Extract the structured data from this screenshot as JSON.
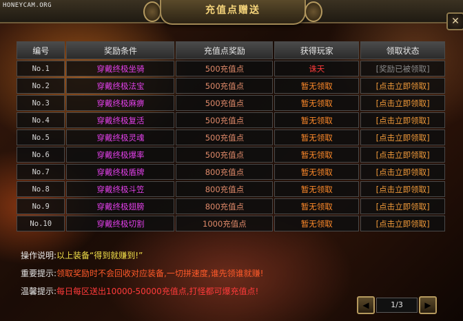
{
  "watermark": "HONEYCAM.ORG",
  "window": {
    "title": "充值点赠送",
    "close_icon": "✕"
  },
  "table": {
    "headers": [
      "编号",
      "奖励条件",
      "充值点奖励",
      "获得玩家",
      "领取状态"
    ],
    "rows": [
      {
        "no": "No.1",
        "condition": "穿戴终极坐骑",
        "reward": "500充值点",
        "player": "诛天",
        "status": "[奖励已被领取]",
        "player_type": "winner",
        "status_type": "claimed"
      },
      {
        "no": "No.2",
        "condition": "穿戴终极法宝",
        "reward": "500充值点",
        "player": "暂无领取",
        "status": "[点击立即领取]",
        "player_type": "none",
        "status_type": "claim"
      },
      {
        "no": "No.3",
        "condition": "穿戴终极麻痹",
        "reward": "500充值点",
        "player": "暂无领取",
        "status": "[点击立即领取]",
        "player_type": "none",
        "status_type": "claim"
      },
      {
        "no": "No.4",
        "condition": "穿戴终极复活",
        "reward": "500充值点",
        "player": "暂无领取",
        "status": "[点击立即领取]",
        "player_type": "none",
        "status_type": "claim"
      },
      {
        "no": "No.5",
        "condition": "穿戴终极灵魂",
        "reward": "500充值点",
        "player": "暂无领取",
        "status": "[点击立即领取]",
        "player_type": "none",
        "status_type": "claim"
      },
      {
        "no": "No.6",
        "condition": "穿戴终极爆率",
        "reward": "500充值点",
        "player": "暂无领取",
        "status": "[点击立即领取]",
        "player_type": "none",
        "status_type": "claim"
      },
      {
        "no": "No.7",
        "condition": "穿戴终极盾牌",
        "reward": "800充值点",
        "player": "暂无领取",
        "status": "[点击立即领取]",
        "player_type": "none",
        "status_type": "claim"
      },
      {
        "no": "No.8",
        "condition": "穿戴终极斗笠",
        "reward": "800充值点",
        "player": "暂无领取",
        "status": "[点击立即领取]",
        "player_type": "none",
        "status_type": "claim"
      },
      {
        "no": "No.9",
        "condition": "穿戴终极翅膀",
        "reward": "800充值点",
        "player": "暂无领取",
        "status": "[点击立即领取]",
        "player_type": "none",
        "status_type": "claim"
      },
      {
        "no": "No.10",
        "condition": "穿戴终极切割",
        "reward": "1000充值点",
        "player": "暂无领取",
        "status": "[点击立即领取]",
        "player_type": "none",
        "status_type": "claim"
      }
    ]
  },
  "notes": [
    {
      "label": "操作说明:",
      "text": "以上装备“得到就赚到!”"
    },
    {
      "label": "重要提示:",
      "text": "领取奖励时不会回收对应装备,一切拼速度,谁先领谁就赚!"
    },
    {
      "label": "温馨提示:",
      "text": "每日每区送出10000-50000充值点,打怪都可爆充值点!"
    }
  ],
  "pager": {
    "page": "1/3",
    "prev_icon": "◀",
    "next_icon": "▶"
  },
  "colors": {
    "condition": "#e040e8",
    "winner": "#ff3b3b",
    "none": "#ff8a2a",
    "claim": "#f09a3a",
    "title": "#f4d37a"
  }
}
